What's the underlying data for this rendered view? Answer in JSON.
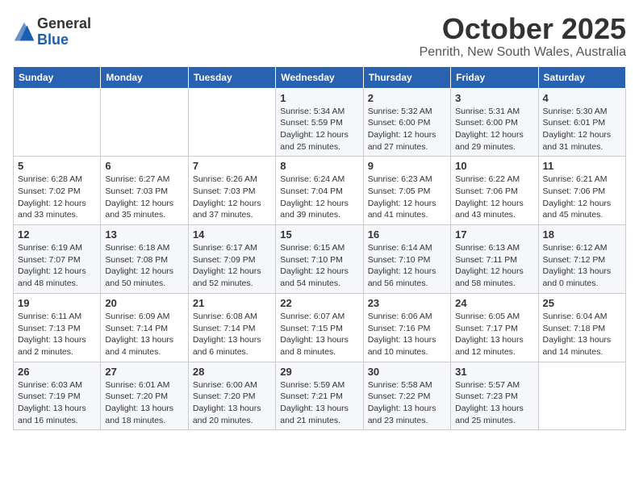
{
  "header": {
    "logo_line1": "General",
    "logo_line2": "Blue",
    "title": "October 2025",
    "subtitle": "Penrith, New South Wales, Australia"
  },
  "weekdays": [
    "Sunday",
    "Monday",
    "Tuesday",
    "Wednesday",
    "Thursday",
    "Friday",
    "Saturday"
  ],
  "weeks": [
    [
      {
        "day": "",
        "info": ""
      },
      {
        "day": "",
        "info": ""
      },
      {
        "day": "",
        "info": ""
      },
      {
        "day": "1",
        "info": "Sunrise: 5:34 AM\nSunset: 5:59 PM\nDaylight: 12 hours\nand 25 minutes."
      },
      {
        "day": "2",
        "info": "Sunrise: 5:32 AM\nSunset: 6:00 PM\nDaylight: 12 hours\nand 27 minutes."
      },
      {
        "day": "3",
        "info": "Sunrise: 5:31 AM\nSunset: 6:00 PM\nDaylight: 12 hours\nand 29 minutes."
      },
      {
        "day": "4",
        "info": "Sunrise: 5:30 AM\nSunset: 6:01 PM\nDaylight: 12 hours\nand 31 minutes."
      }
    ],
    [
      {
        "day": "5",
        "info": "Sunrise: 6:28 AM\nSunset: 7:02 PM\nDaylight: 12 hours\nand 33 minutes."
      },
      {
        "day": "6",
        "info": "Sunrise: 6:27 AM\nSunset: 7:03 PM\nDaylight: 12 hours\nand 35 minutes."
      },
      {
        "day": "7",
        "info": "Sunrise: 6:26 AM\nSunset: 7:03 PM\nDaylight: 12 hours\nand 37 minutes."
      },
      {
        "day": "8",
        "info": "Sunrise: 6:24 AM\nSunset: 7:04 PM\nDaylight: 12 hours\nand 39 minutes."
      },
      {
        "day": "9",
        "info": "Sunrise: 6:23 AM\nSunset: 7:05 PM\nDaylight: 12 hours\nand 41 minutes."
      },
      {
        "day": "10",
        "info": "Sunrise: 6:22 AM\nSunset: 7:06 PM\nDaylight: 12 hours\nand 43 minutes."
      },
      {
        "day": "11",
        "info": "Sunrise: 6:21 AM\nSunset: 7:06 PM\nDaylight: 12 hours\nand 45 minutes."
      }
    ],
    [
      {
        "day": "12",
        "info": "Sunrise: 6:19 AM\nSunset: 7:07 PM\nDaylight: 12 hours\nand 48 minutes."
      },
      {
        "day": "13",
        "info": "Sunrise: 6:18 AM\nSunset: 7:08 PM\nDaylight: 12 hours\nand 50 minutes."
      },
      {
        "day": "14",
        "info": "Sunrise: 6:17 AM\nSunset: 7:09 PM\nDaylight: 12 hours\nand 52 minutes."
      },
      {
        "day": "15",
        "info": "Sunrise: 6:15 AM\nSunset: 7:10 PM\nDaylight: 12 hours\nand 54 minutes."
      },
      {
        "day": "16",
        "info": "Sunrise: 6:14 AM\nSunset: 7:10 PM\nDaylight: 12 hours\nand 56 minutes."
      },
      {
        "day": "17",
        "info": "Sunrise: 6:13 AM\nSunset: 7:11 PM\nDaylight: 12 hours\nand 58 minutes."
      },
      {
        "day": "18",
        "info": "Sunrise: 6:12 AM\nSunset: 7:12 PM\nDaylight: 13 hours\nand 0 minutes."
      }
    ],
    [
      {
        "day": "19",
        "info": "Sunrise: 6:11 AM\nSunset: 7:13 PM\nDaylight: 13 hours\nand 2 minutes."
      },
      {
        "day": "20",
        "info": "Sunrise: 6:09 AM\nSunset: 7:14 PM\nDaylight: 13 hours\nand 4 minutes."
      },
      {
        "day": "21",
        "info": "Sunrise: 6:08 AM\nSunset: 7:14 PM\nDaylight: 13 hours\nand 6 minutes."
      },
      {
        "day": "22",
        "info": "Sunrise: 6:07 AM\nSunset: 7:15 PM\nDaylight: 13 hours\nand 8 minutes."
      },
      {
        "day": "23",
        "info": "Sunrise: 6:06 AM\nSunset: 7:16 PM\nDaylight: 13 hours\nand 10 minutes."
      },
      {
        "day": "24",
        "info": "Sunrise: 6:05 AM\nSunset: 7:17 PM\nDaylight: 13 hours\nand 12 minutes."
      },
      {
        "day": "25",
        "info": "Sunrise: 6:04 AM\nSunset: 7:18 PM\nDaylight: 13 hours\nand 14 minutes."
      }
    ],
    [
      {
        "day": "26",
        "info": "Sunrise: 6:03 AM\nSunset: 7:19 PM\nDaylight: 13 hours\nand 16 minutes."
      },
      {
        "day": "27",
        "info": "Sunrise: 6:01 AM\nSunset: 7:20 PM\nDaylight: 13 hours\nand 18 minutes."
      },
      {
        "day": "28",
        "info": "Sunrise: 6:00 AM\nSunset: 7:20 PM\nDaylight: 13 hours\nand 20 minutes."
      },
      {
        "day": "29",
        "info": "Sunrise: 5:59 AM\nSunset: 7:21 PM\nDaylight: 13 hours\nand 21 minutes."
      },
      {
        "day": "30",
        "info": "Sunrise: 5:58 AM\nSunset: 7:22 PM\nDaylight: 13 hours\nand 23 minutes."
      },
      {
        "day": "31",
        "info": "Sunrise: 5:57 AM\nSunset: 7:23 PM\nDaylight: 13 hours\nand 25 minutes."
      },
      {
        "day": "",
        "info": ""
      }
    ]
  ]
}
